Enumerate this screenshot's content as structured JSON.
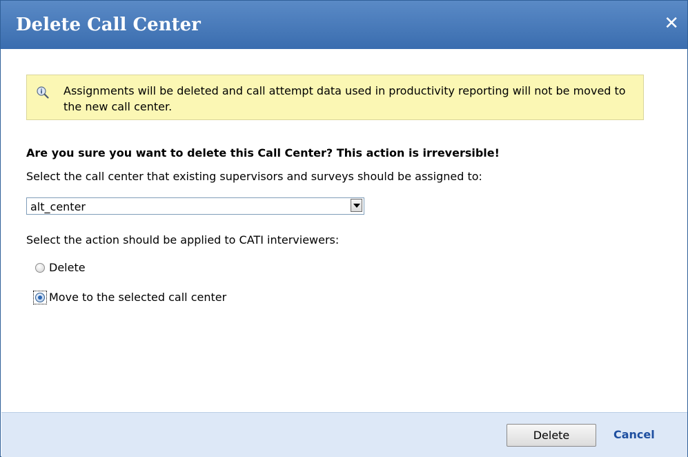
{
  "dialog": {
    "title": "Delete Call Center",
    "close_icon": "close-icon",
    "notice": {
      "icon": "info-magnifier-icon",
      "text": "Assignments will be deleted and call attempt data used in productivity reporting will not be moved to the new call center."
    },
    "question": "Are you sure you want to delete this Call Center? This action is irreversible!",
    "select_label": "Select the call center that existing supervisors and surveys should be assigned to:",
    "select_value": "alt_center",
    "action_label": "Select the action should be applied to CATI interviewers:",
    "radios": [
      {
        "label": "Delete",
        "checked": false
      },
      {
        "label": "Move to the selected call center",
        "checked": true
      }
    ],
    "buttons": {
      "delete": "Delete",
      "cancel": "Cancel"
    },
    "colors": {
      "titlebar": "#3a6daf",
      "notice_bg": "#fbf7b4",
      "footer_bg": "#dde8f7",
      "cancel_link": "#1e4fa0"
    }
  }
}
